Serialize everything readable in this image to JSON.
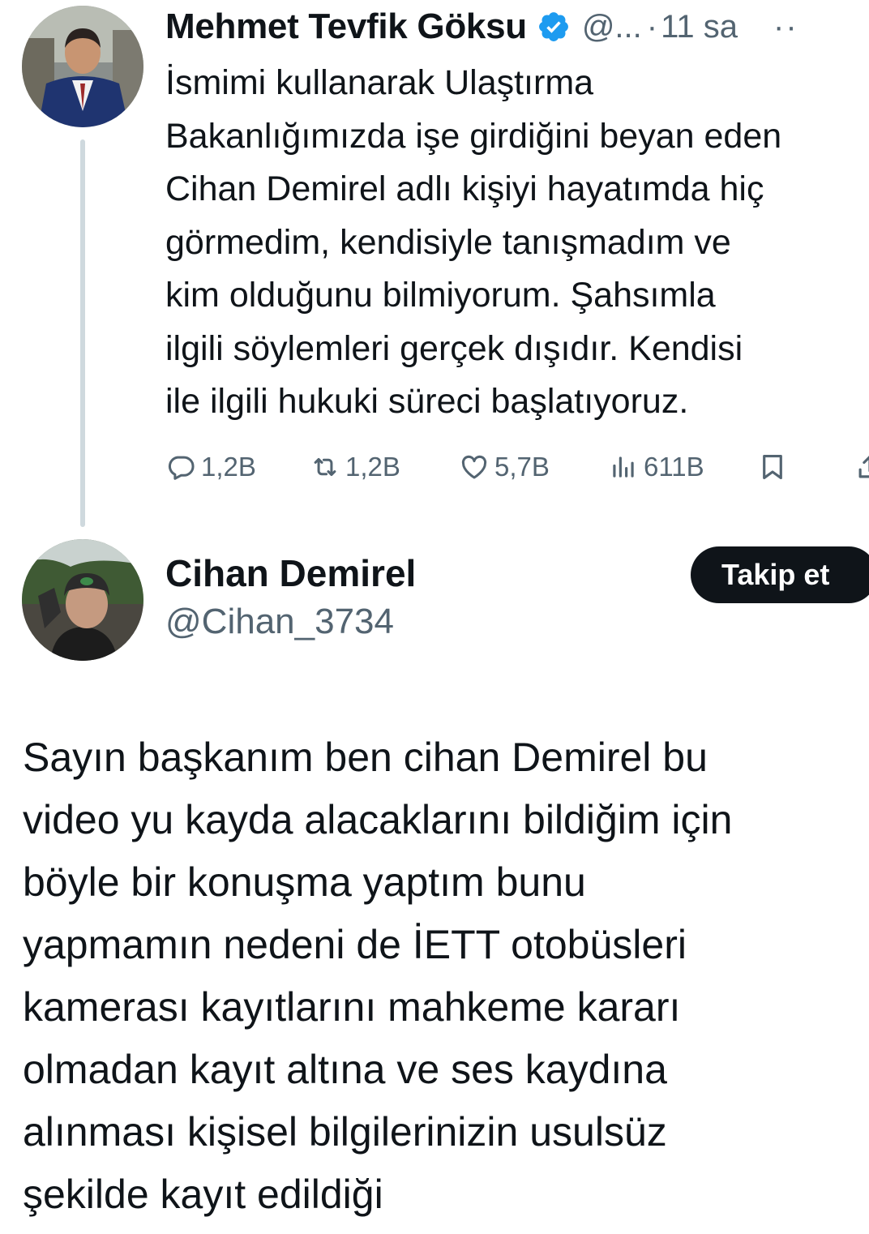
{
  "tweet": {
    "author": {
      "display_name": "Mehmet Tevfik Göksu",
      "handle_truncated": "@...",
      "verified": true,
      "avatar": "avatar-man-in-suit"
    },
    "separator": "·",
    "time": "11 sa",
    "more_icon": "more-icon",
    "text_lines": [
      "İsmimi kullanarak Ulaştırma",
      "Bakanlığımızda işe girdiğini beyan eden",
      "Cihan Demirel adlı kişiyi hayatımda hiç",
      "görmedim, kendisiyle tanışmadım ve",
      "kim olduğunu bilmiyorum. Şahsımla",
      "ilgili söylemleri gerçek dışıdır. Kendisi",
      "ile ilgili hukuki süreci başlatıyoruz."
    ],
    "actions": {
      "replies": "1,2B",
      "retweets": "1,2B",
      "likes": "5,7B",
      "views": "611B"
    }
  },
  "user_card": {
    "display_name": "Cihan Demirel",
    "handle": "@Cihan_3734",
    "avatar": "avatar-man-with-cap",
    "follow_label": "Takip et"
  },
  "post_text_lines": [
    "Sayın başkanım ben cihan Demirel bu",
    "video yu kayda alacaklarını bildiğim için",
    "böyle bir konuşma yaptım bunu",
    "yapmamın nedeni de İETT otobüsleri",
    "kamerası kayıtlarını mahkeme kararı",
    "olmadan kayıt altına ve ses kaydına",
    "alınması kişisel bilgilerinizin usulsüz",
    "şekilde kayıt edildiği"
  ],
  "colors": {
    "text": "#0f1419",
    "secondary": "#536471",
    "thread_line": "#cfd9de",
    "verified": "#1d9bf0",
    "button_bg": "#0f1419"
  }
}
